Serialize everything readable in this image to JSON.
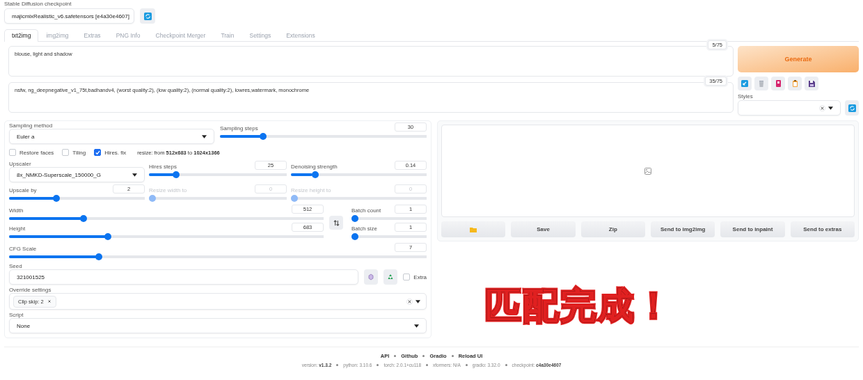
{
  "checkpoint": {
    "label": "Stable Diffusion checkpoint",
    "value": "majicmixRealistic_v6.safetensors [e4a30e4607]"
  },
  "tabs": [
    {
      "label": "txt2img",
      "selected": true
    },
    {
      "label": "img2img",
      "selected": false
    },
    {
      "label": "Extras",
      "selected": false
    },
    {
      "label": "PNG Info",
      "selected": false
    },
    {
      "label": "Checkpoint Merger",
      "selected": false
    },
    {
      "label": "Train",
      "selected": false
    },
    {
      "label": "Settings",
      "selected": false
    },
    {
      "label": "Extensions",
      "selected": false
    }
  ],
  "prompt": {
    "text": "blouse, light and shadow",
    "token_count": "5/75"
  },
  "negative_prompt": {
    "text": "nsfw, ng_deepnegative_v1_75t,badhandv4, (worst quality:2), (low quality:2), (normal quality:2), lowres,watermark, monochrome",
    "token_count": "35/75"
  },
  "generate": {
    "label": "Generate"
  },
  "styles": {
    "label": "Styles"
  },
  "sampling_method": {
    "label": "Sampling method",
    "value": "Euler a"
  },
  "sampling_steps": {
    "label": "Sampling steps",
    "value": "30",
    "level": 0.2,
    "disabled": false
  },
  "checkboxes": [
    {
      "label": "Restore faces",
      "checked": false
    },
    {
      "label": "Tiling",
      "checked": false
    },
    {
      "label": "Hires. fix",
      "checked": true
    }
  ],
  "resize_note": "resize: from **512x683** to **1024x1366**",
  "upscaler": {
    "label": "Upscaler",
    "value": "8x_NMKD-Superscale_150000_G"
  },
  "hires_steps": {
    "label": "Hires steps",
    "value": "25",
    "level": 0.18,
    "disabled": false
  },
  "denoising_strength": {
    "label": "Denoising strength",
    "value": "0.14",
    "level": 0.16,
    "disabled": false
  },
  "upscale_by": {
    "label": "Upscale by",
    "value": "2",
    "level": 0.34,
    "disabled": false
  },
  "resize_width": {
    "label": "Resize width to",
    "value": "0",
    "level": 0,
    "disabled": true
  },
  "resize_height": {
    "label": "Resize height to",
    "value": "0",
    "level": 0,
    "disabled": true
  },
  "width": {
    "label": "Width",
    "value": "512",
    "level": 0.23,
    "disabled": false
  },
  "height": {
    "label": "Height",
    "value": "683",
    "level": 0.31,
    "disabled": false
  },
  "batch_count": {
    "label": "Batch count",
    "value": "1",
    "level": 0,
    "disabled": false
  },
  "batch_size": {
    "label": "Batch size",
    "value": "1",
    "level": 0,
    "disabled": false
  },
  "cfg_scale": {
    "label": "CFG Scale",
    "value": "7",
    "level": 0.21,
    "disabled": false
  },
  "seed": {
    "label": "Seed",
    "value": "321001525"
  },
  "extra": {
    "label": "Extra",
    "checked": false
  },
  "override_settings": {
    "label": "Override settings",
    "chips": [
      {
        "label": "Clip skip: 2"
      }
    ]
  },
  "script": {
    "label": "Script",
    "value": "None"
  },
  "gallery_buttons": [
    {
      "kind": "folder"
    },
    {
      "kind": "text",
      "label": "Save"
    },
    {
      "kind": "text",
      "label": "Zip"
    },
    {
      "kind": "text",
      "label": "Send to img2img"
    },
    {
      "kind": "text",
      "label": "Send to inpaint"
    },
    {
      "kind": "text",
      "label": "Send to extras"
    }
  ],
  "footer_links": [
    "API",
    "Github",
    "Gradio",
    "Reload UI"
  ],
  "footer_info": [
    "version: **v1.3.2**",
    "python: 3.10.6",
    "torch: 2.0.1+cu118",
    "xformers: N/A",
    "gradio: 3.32.0",
    "checkpoint: **c4a30e4607**"
  ],
  "annotation": "匹配完成！"
}
